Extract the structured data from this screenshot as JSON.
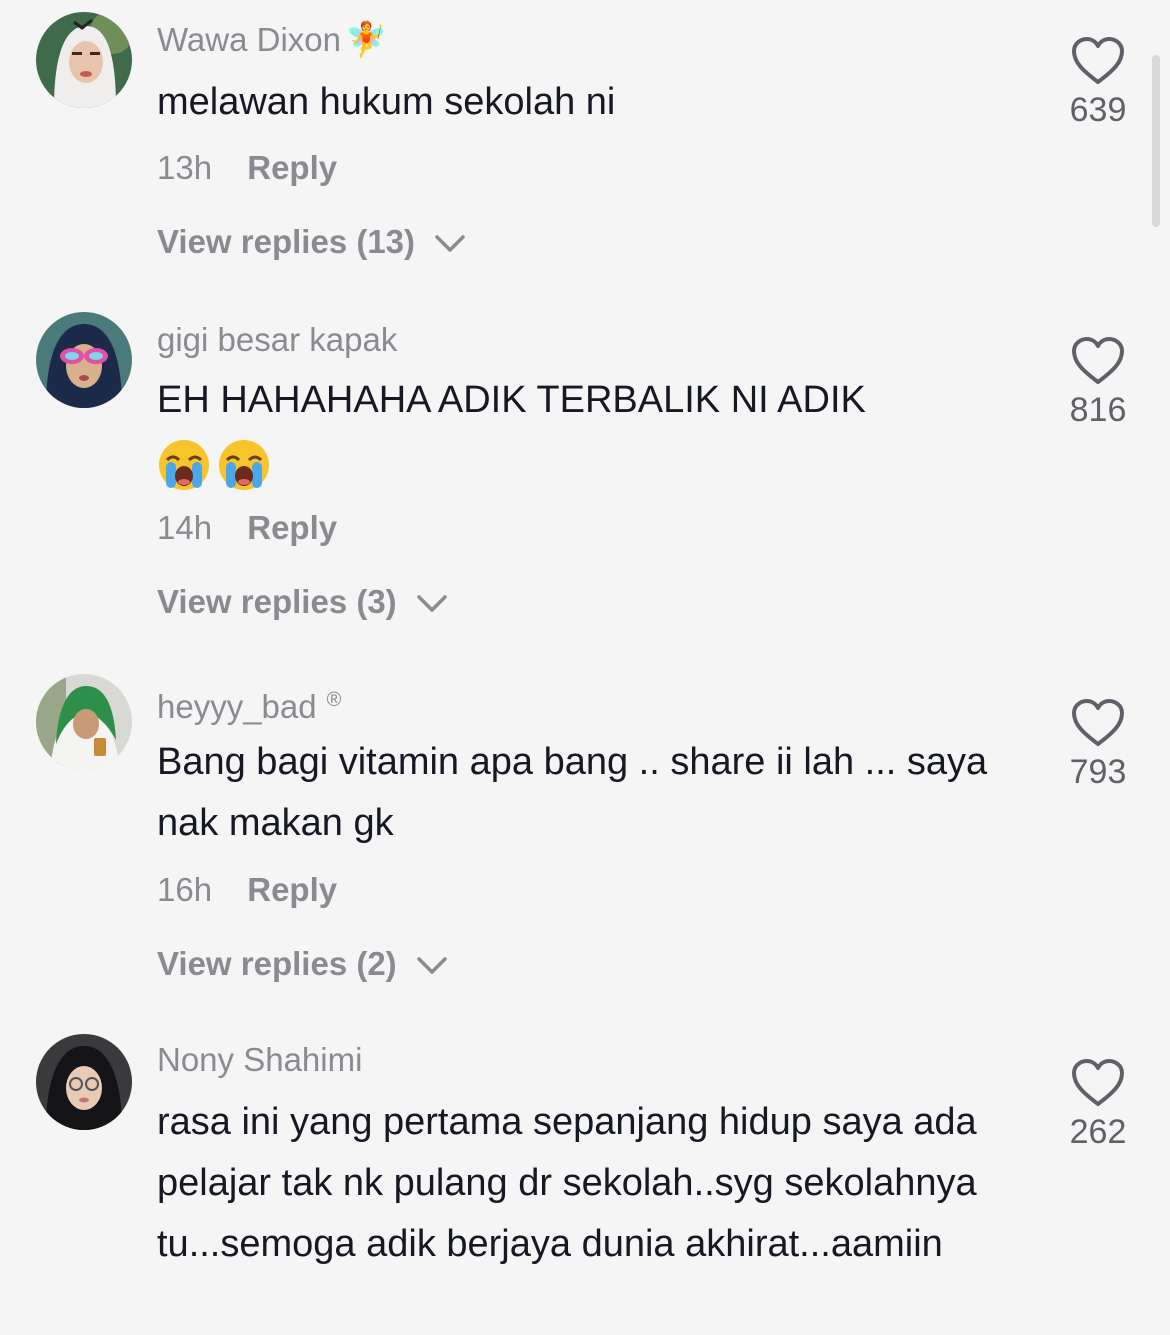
{
  "comments": [
    {
      "username": "Wawa Dixon",
      "username_extra": "🧚",
      "text": "melawan hukum sekolah ni",
      "time": "13h",
      "reply_label": "Reply",
      "view_replies": "View replies (13)",
      "likes": "639",
      "avatar_icon": "avatar-hijab-white"
    },
    {
      "username": "gigi besar kapak",
      "text": "EH HAHAHAHA ADIK TERBALIK NI ADIK",
      "emojis": [
        "loudly-crying-face",
        "loudly-crying-face"
      ],
      "time": "14h",
      "reply_label": "Reply",
      "view_replies": "View replies (3)",
      "likes": "816",
      "avatar_icon": "avatar-hijab-navy-glasses"
    },
    {
      "username": "heyyy_bad",
      "username_extra": "®",
      "text": "Bang bagi vitamin apa bang .. share ii lah ... saya nak makan gk",
      "time": "16h",
      "reply_label": "Reply",
      "view_replies": "View replies (2)",
      "likes": "793",
      "avatar_icon": "avatar-green-cloth"
    },
    {
      "username": "Nony Shahimi",
      "text": "rasa ini yang pertama sepanjang hidup saya ada pelajar tak nk pulang dr sekolah..syg sekolahnya tu...semoga adik berjaya dunia akhirat...aamiin",
      "likes": "262",
      "avatar_icon": "avatar-hijab-black-glasses"
    }
  ],
  "colors": {
    "background": "#f5f5f6",
    "text": "#161823",
    "secondary": "#8a8b91",
    "like_count": "#5f6068"
  }
}
